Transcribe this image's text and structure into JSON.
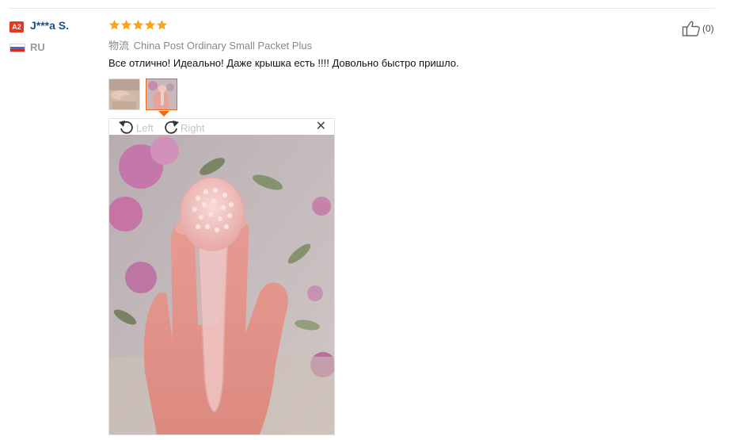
{
  "reviewer": {
    "level": "A2",
    "name": "J***a S.",
    "country": "RU"
  },
  "review": {
    "rating": 5,
    "logistics_prefix": "物流",
    "logistics": "China Post Ordinary Small Packet Plus",
    "text": "Все отлично! Идеально! Даже крышка есть !!!! Довольно быстро пришло."
  },
  "viewer": {
    "rotate_left_label": "Left",
    "rotate_right_label": "Right",
    "close_glyph": "✕"
  },
  "helpful": {
    "count": "(0)"
  },
  "colors": {
    "star": "#f7a61c",
    "badge": "#e4391e",
    "name": "#1a4f8a",
    "selected_border": "#e86a1a"
  },
  "icons": [
    "star-icon",
    "rotate-left-icon",
    "rotate-right-icon",
    "close-icon",
    "thumbs-up-icon",
    "russia-flag-icon"
  ]
}
